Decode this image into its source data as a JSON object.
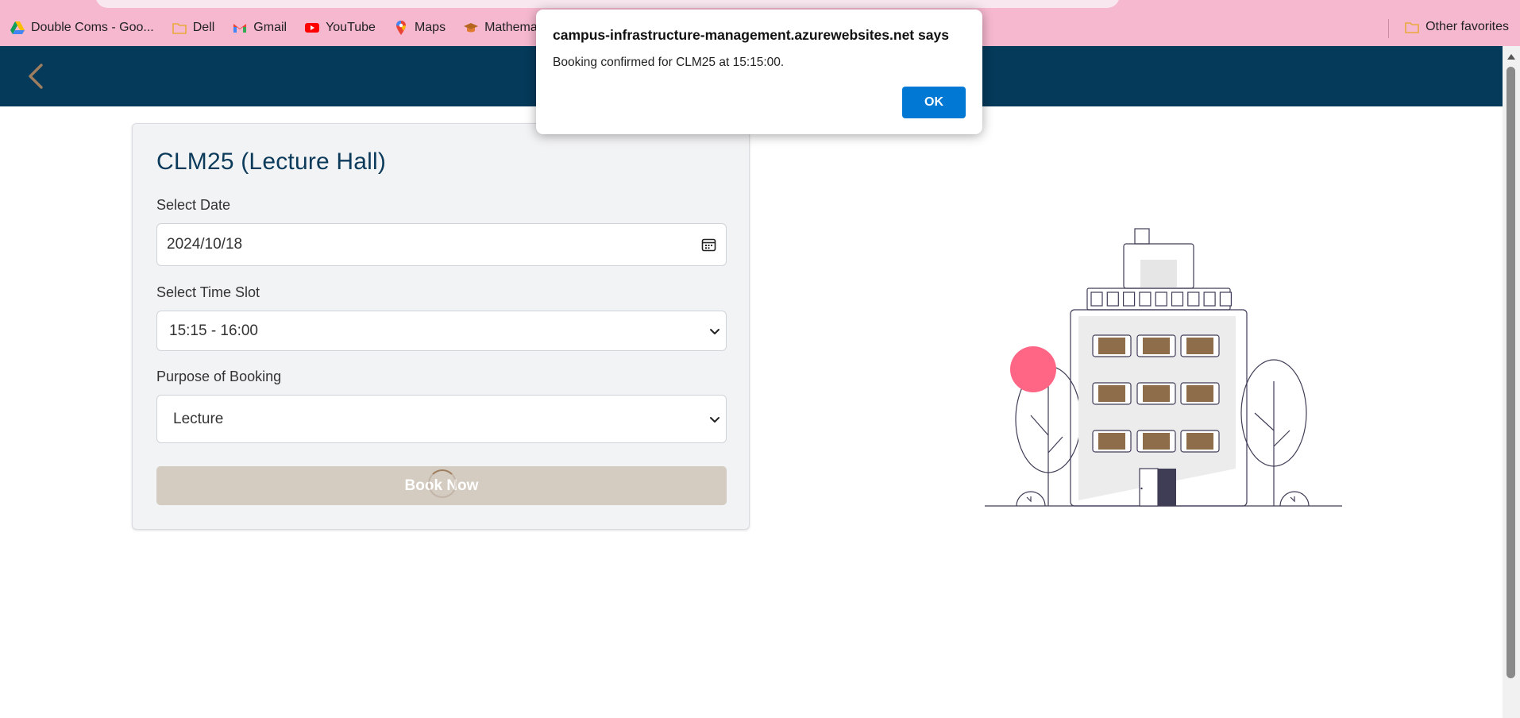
{
  "browser": {
    "bookmarks": [
      {
        "label": "Double Coms - Goo...",
        "icon": "google-drive-icon"
      },
      {
        "label": "Dell",
        "icon": "folder-icon"
      },
      {
        "label": "Gmail",
        "icon": "gmail-icon"
      },
      {
        "label": "YouTube",
        "icon": "youtube-icon"
      },
      {
        "label": "Maps",
        "icon": "maps-icon"
      },
      {
        "label": "Mathematical",
        "icon": "graduation-cap-icon"
      }
    ],
    "other_favorites": "Other favorites"
  },
  "header": {
    "back_icon": "chevron-left-icon",
    "back_color": "#9e7e5e",
    "bg_color": "#053a5a"
  },
  "form": {
    "title": "CLM25 (Lecture Hall)",
    "date_label": "Select Date",
    "date_value": "2024/10/18",
    "time_label": "Select Time Slot",
    "time_value": "15:15 - 16:00",
    "purpose_label": "Purpose of Booking",
    "purpose_value": "Lecture",
    "submit_label": "Book Now"
  },
  "dialog": {
    "title": "campus-infrastructure-management.azurewebsites.net says",
    "message": "Booking confirmed for CLM25 at 15:15:00.",
    "ok_label": "OK"
  },
  "colors": {
    "accent": "#9e7e5e",
    "pink": "#ff6584",
    "dialog_button": "#0078d4"
  }
}
